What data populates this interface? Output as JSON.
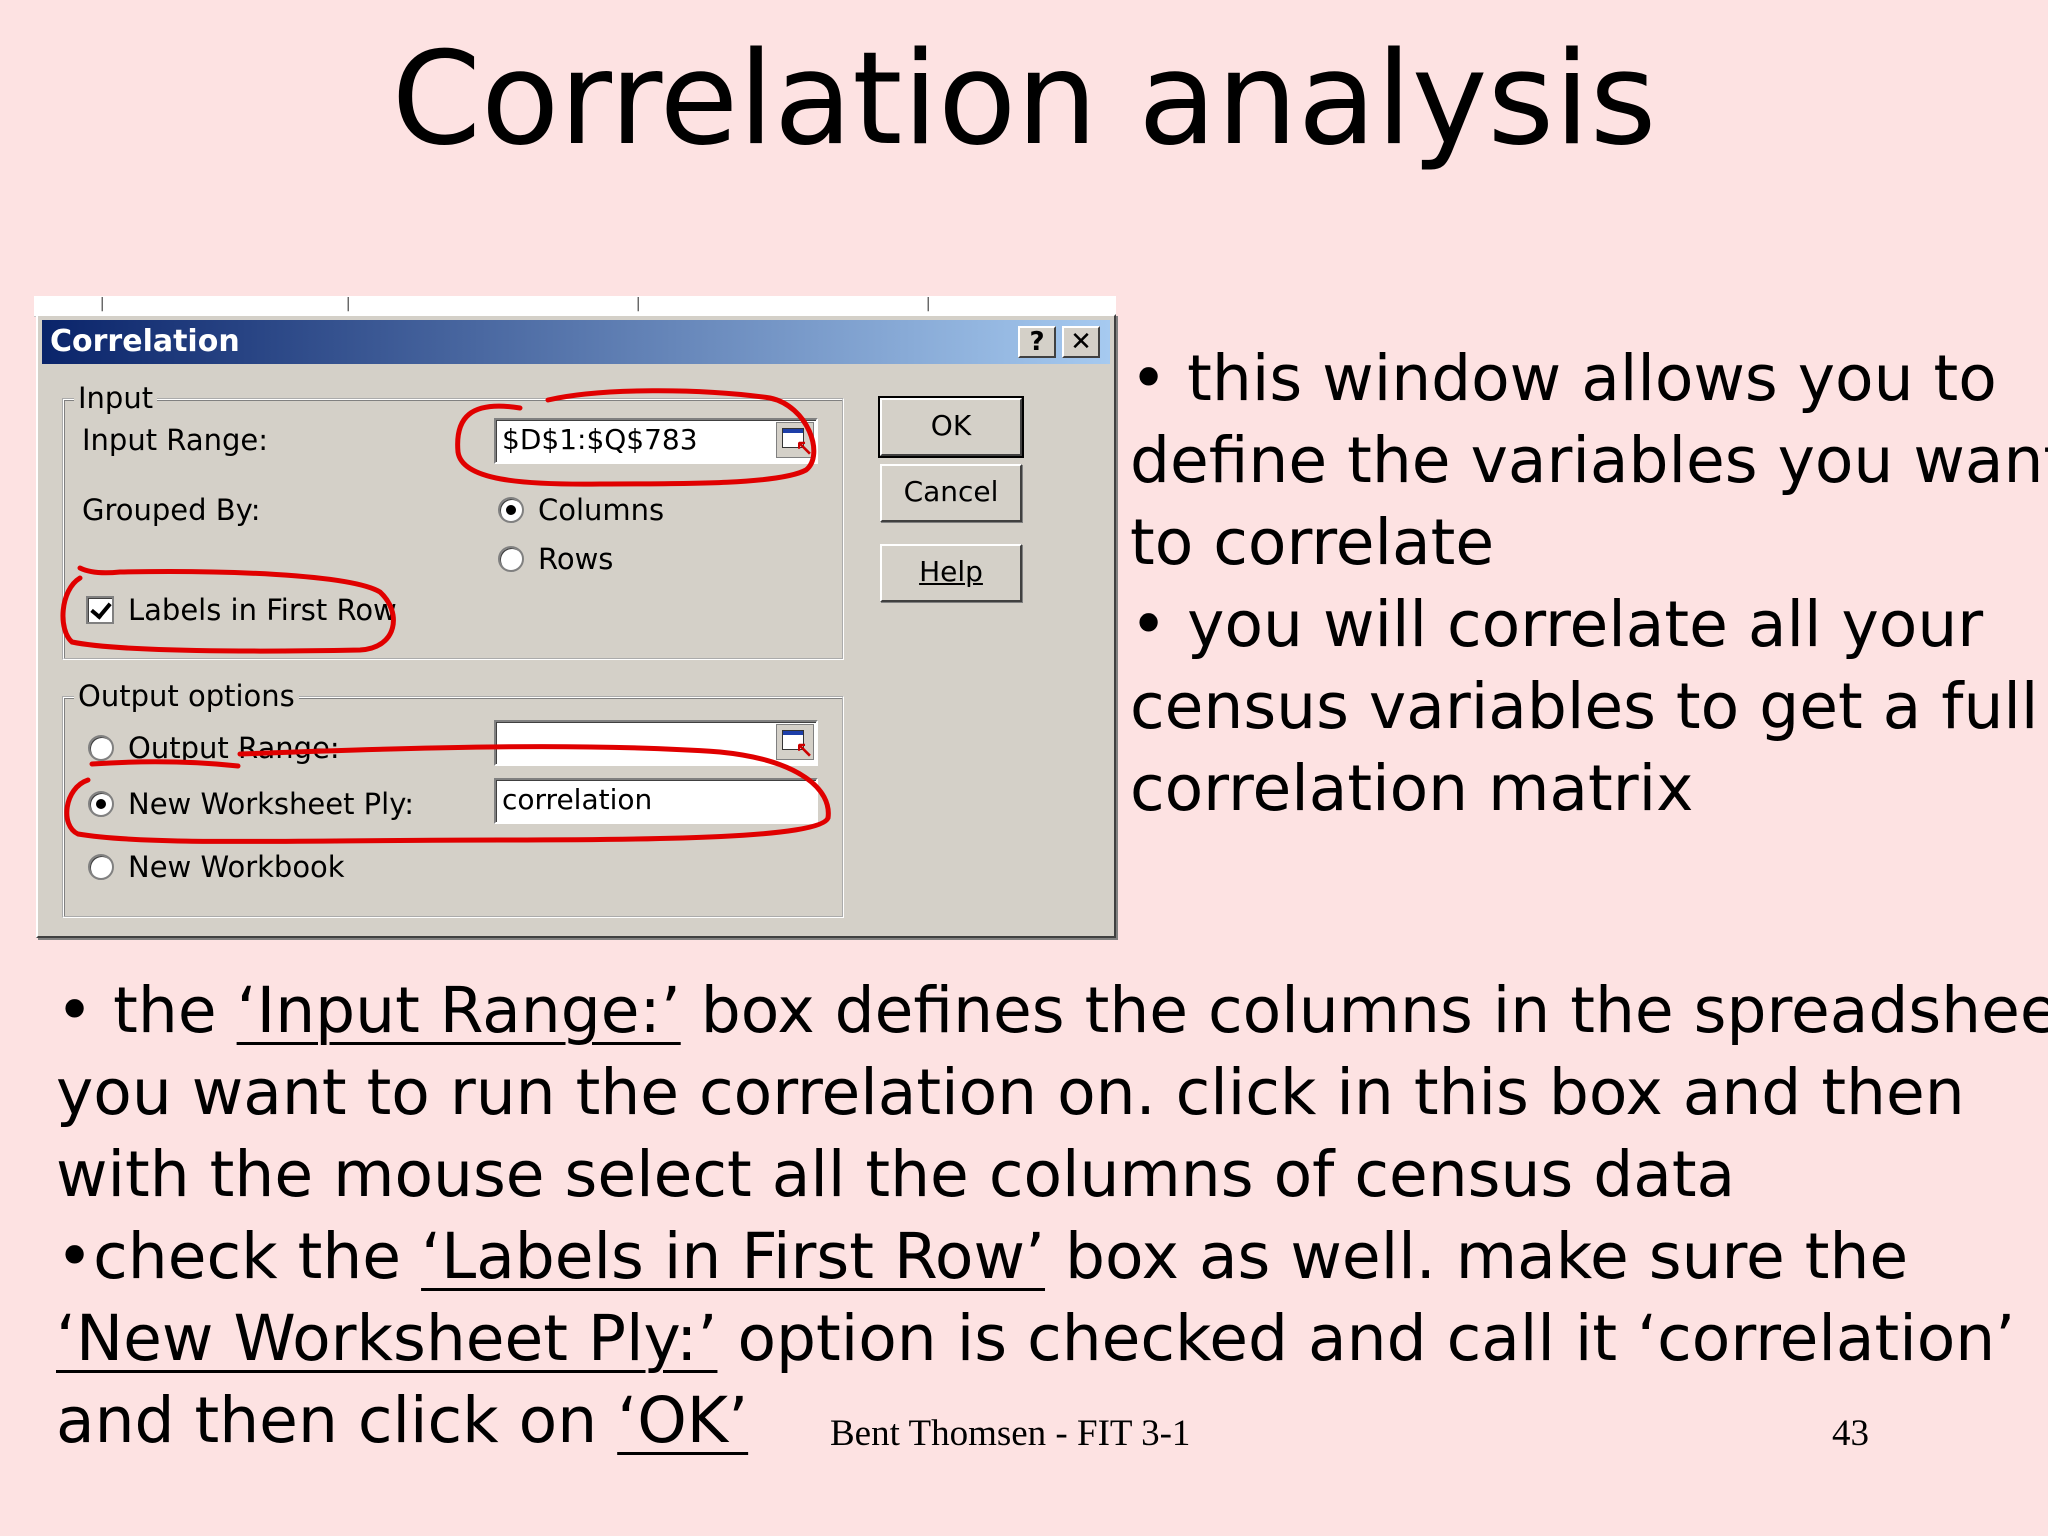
{
  "slide": {
    "title": "Correlation analysis",
    "footer_author": "Bent Thomsen - FIT 3-1",
    "page_number": "43"
  },
  "dialog": {
    "title": "Correlation",
    "help_glyph": "?",
    "close_glyph": "✕",
    "input_group": {
      "legend": "Input",
      "input_range_label": "Input Range:",
      "input_range_value": "$D$1:$Q$783",
      "grouped_by_label": "Grouped By:",
      "columns_label": "Columns",
      "rows_label": "Rows",
      "grouped_by_selected": "Columns",
      "labels_first_row_label": "Labels in First Row",
      "labels_first_row_checked": true
    },
    "output_group": {
      "legend": "Output options",
      "output_range_label": "Output Range:",
      "output_range_value": "",
      "new_worksheet_label": "New Worksheet Ply:",
      "new_worksheet_value": "correlation",
      "new_workbook_label": "New Workbook",
      "selected": "New Worksheet Ply:"
    },
    "buttons": {
      "ok": "OK",
      "cancel": "Cancel",
      "help": "Help"
    },
    "picker_icon": "range-picker-icon"
  },
  "annotation_color": "#e00000",
  "right_text": {
    "line1": "• this window allows you to",
    "line2": "define the variables you want",
    "line3": "to correlate",
    "line4": "• you will correlate all your",
    "line5": "census variables to get a full",
    "line6": "correlation matrix"
  },
  "bottom_text": {
    "l1_pre": "• the ",
    "l1_link": "‘Input Range:’",
    "l1_post": " box defines the columns in the spreadsheet",
    "l2": "you want to run the correlation on. click in this box and then",
    "l3": "with the mouse select all the columns of census data",
    "l4_pre": "•check the ",
    "l4_link": "‘Labels in First Row’",
    "l4_post": " box as well. make sure the",
    "l5_link": "‘New Worksheet Ply:’",
    "l5_post": " option is checked and call it ‘correlation’",
    "l6_pre": "and then click on ",
    "l6_link": "‘OK’"
  }
}
